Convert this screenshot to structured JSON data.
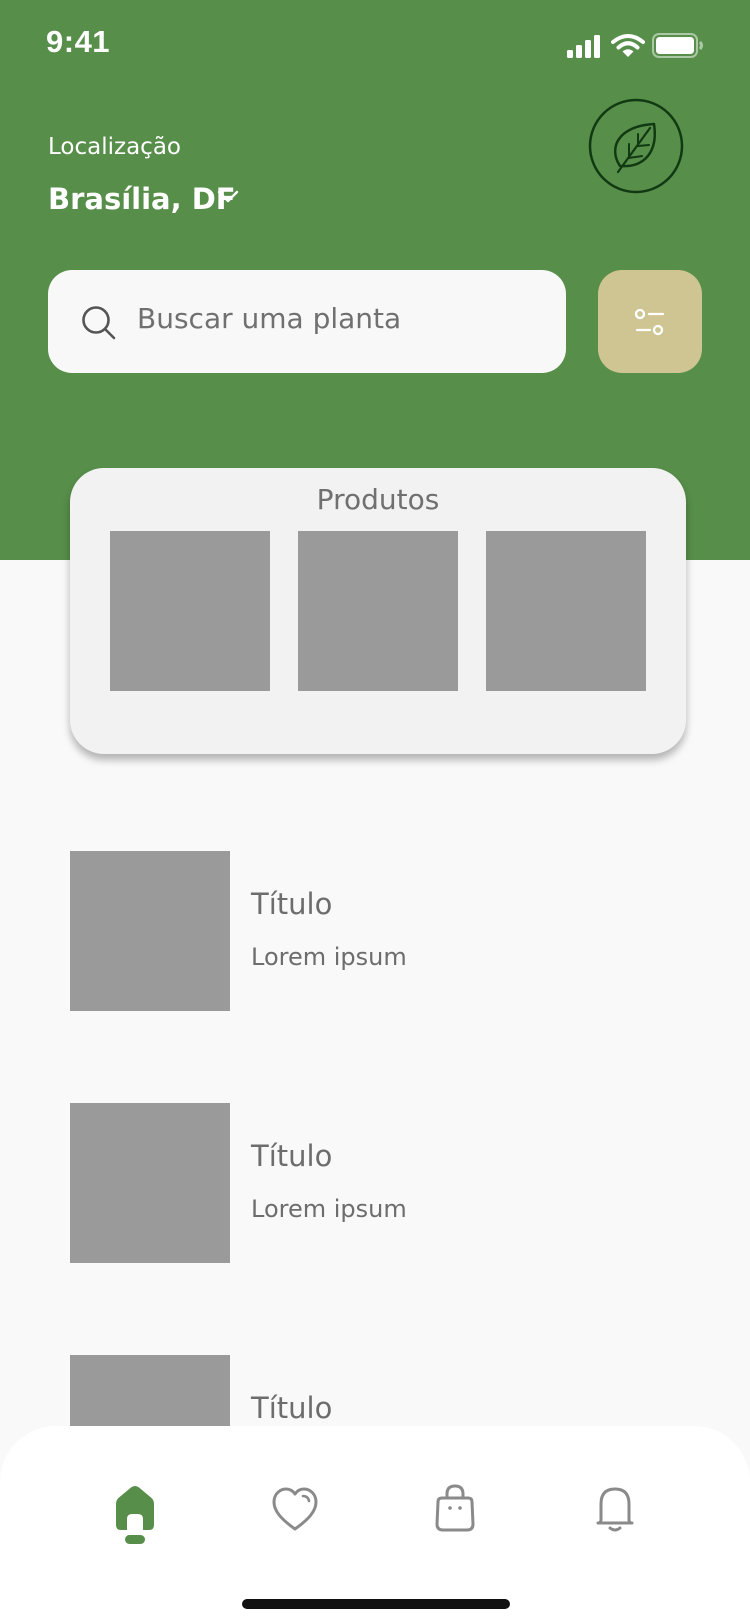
{
  "status_bar": {
    "time": "9:41"
  },
  "header": {
    "location_label": "Localização",
    "location_value": "Brasília, DF"
  },
  "search": {
    "placeholder": "Buscar uma planta"
  },
  "products": {
    "title": "Produtos"
  },
  "list": [
    {
      "title": "Título",
      "subtitle": "Lorem ipsum"
    },
    {
      "title": "Título",
      "subtitle": "Lorem ipsum"
    },
    {
      "title": "Título",
      "subtitle": ""
    }
  ],
  "nav": {
    "items": [
      "home-icon",
      "heart-icon",
      "bag-icon",
      "bell-icon"
    ],
    "active": "home-icon"
  },
  "colors": {
    "primary": "#578e4a",
    "accent": "#cfc592",
    "placeholder": "#9a9a9a"
  }
}
